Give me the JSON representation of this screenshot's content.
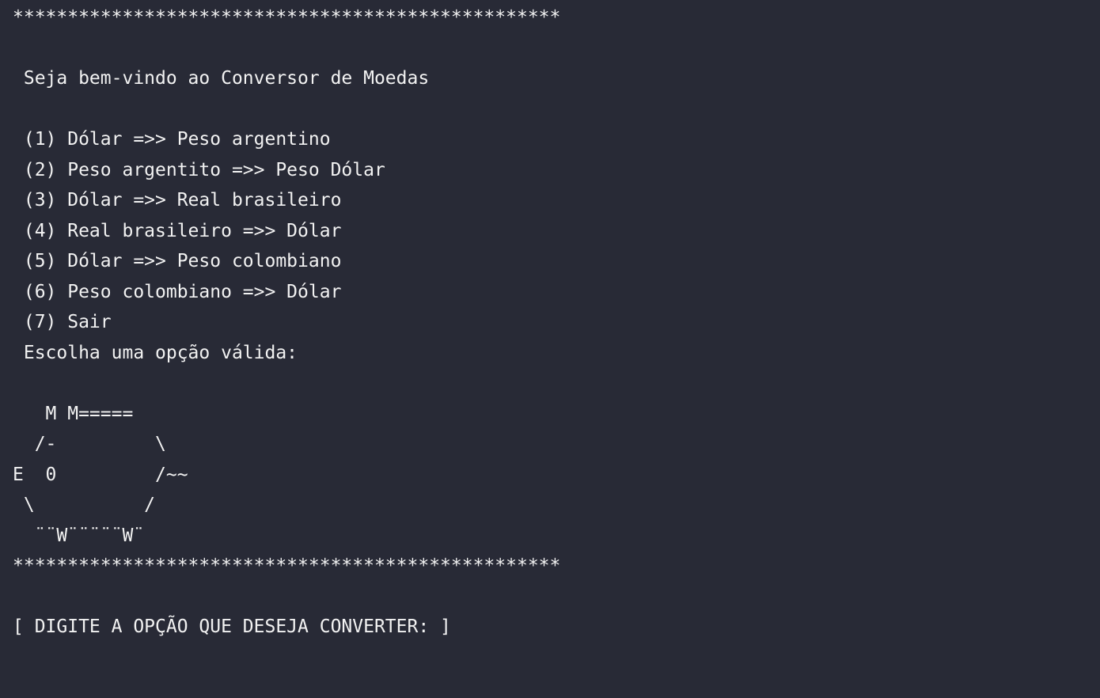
{
  "console": {
    "separator_top": "**************************************************",
    "welcome": " Seja bem-vindo ao Conversor de Moedas",
    "menu_items": [
      " (1) Dólar =>> Peso argentino",
      " (2) Peso argentito =>> Peso Dólar",
      " (3) Dólar =>> Real brasileiro",
      " (4) Real brasileiro =>> Dólar",
      " (5) Dólar =>> Peso colombiano",
      " (6) Peso colombiano =>> Dólar",
      " (7) Sair"
    ],
    "choose_prompt": " Escolha uma opção válida:",
    "ascii_art": [
      "   M M=====",
      "  /-         \\",
      "E  0         /~~",
      " \\          /",
      "  ¨¨W¨¨¨¨¨W¨"
    ],
    "separator_bottom": "**************************************************",
    "input_prompt": "[ DIGITE A OPÇÃO QUE DESEJA CONVERTER: ]"
  },
  "colors": {
    "background": "#282a36",
    "foreground": "#f2f2f2"
  }
}
